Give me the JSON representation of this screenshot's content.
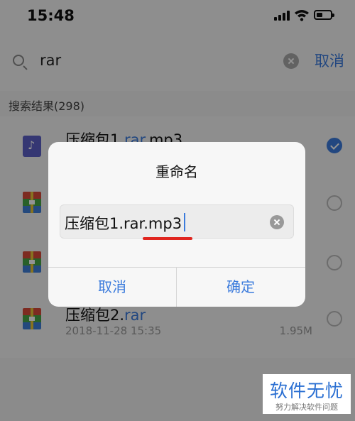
{
  "status_bar": {
    "time": "15:48"
  },
  "search": {
    "query": "rar",
    "cancel_label": "取消"
  },
  "results": {
    "header": "搜索结果(298)"
  },
  "files": [
    {
      "name_prefix": "压缩包1.",
      "name_highlight": "rar",
      "name_suffix": ".mp3",
      "icon": "music-file-icon",
      "selected": true,
      "date": "",
      "size": ""
    },
    {
      "name_prefix": "",
      "name_highlight": "",
      "name_suffix": "",
      "icon": "zip-file-icon",
      "selected": false,
      "date": "",
      "size": ""
    },
    {
      "name_prefix": "",
      "name_highlight": "",
      "name_suffix": "",
      "icon": "zip-file-icon",
      "selected": false,
      "date": "",
      "size": ""
    },
    {
      "name_prefix": "压缩包2.",
      "name_highlight": "rar",
      "name_suffix": "",
      "icon": "zip-file-icon",
      "selected": false,
      "date": "2018-11-28 15:35",
      "size": "1.95M"
    }
  ],
  "dialog": {
    "title": "重命名",
    "value": "压缩包1.rar.mp3",
    "cancel_label": "取消",
    "confirm_label": "确定"
  },
  "watermark": {
    "main": "软件无忧",
    "sub": "努力解决软件问题"
  },
  "colors": {
    "accent": "#3b7bdc",
    "underline": "#e0261f"
  }
}
